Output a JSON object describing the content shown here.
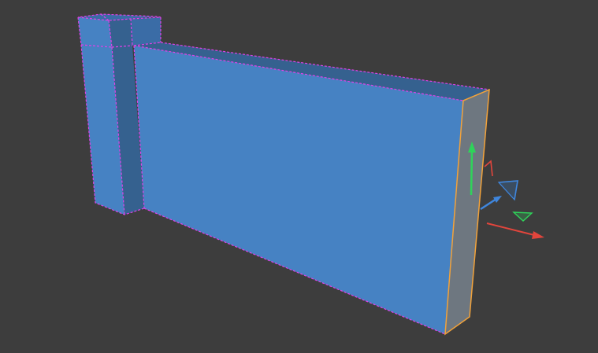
{
  "viewport": {
    "background": "#3d3d3d",
    "grid_color": "#353535"
  },
  "model": {
    "face_front_color": "#4682c3",
    "face_top_color": "#3a6ca6",
    "face_side_dark_color": "#35618f",
    "selected_face_color": "#6e7780",
    "edge_color": "#e040e8",
    "selected_edge_color": "#f2a23a"
  },
  "gizmo": {
    "y_axis_color": "#2fd35a",
    "x_axis_color": "#e2453c",
    "z_axis_color": "#3f86dd",
    "icons": [
      "move-y-arrow-icon",
      "move-x-arrow-icon",
      "move-z-arrow-icon",
      "rotate-plane-xy-icon",
      "rotate-plane-yz-icon",
      "rotate-plane-xz-icon"
    ]
  }
}
